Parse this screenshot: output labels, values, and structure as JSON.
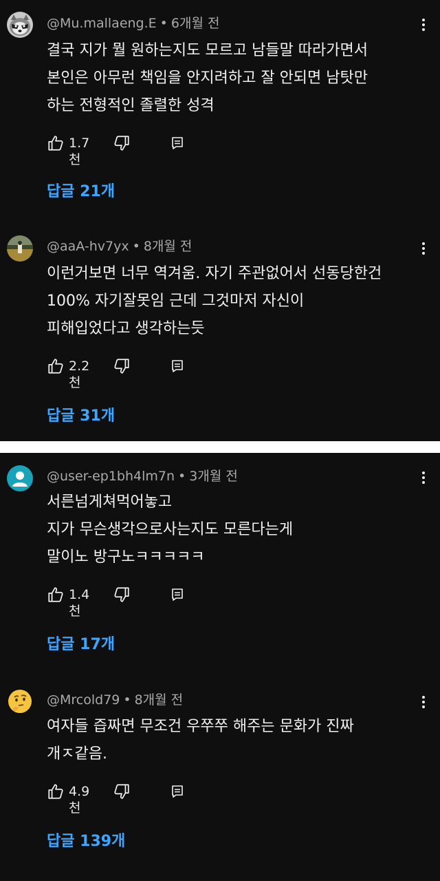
{
  "comments": [
    {
      "author": "@Mu.mallaeng.E",
      "time": "6개월 전",
      "lines": [
        "결국 지가 뭘 원하는지도 모르고 남들말 따라가면서",
        "본인은 아무런 책임을 안지려하고 잘 안되면 남탓만",
        "하는 전형적인 졸렬한 성격"
      ],
      "likes": "1.7천",
      "replies": "답글 21개",
      "avatar": "raccoon-avatar"
    },
    {
      "author": "@aaA-hv7yx",
      "time": "8개월 전",
      "lines": [
        "이런거보면 너무 역겨움. 자기 주관없어서 선동당한건",
        "100% 자기잘못임 근데 그것마저 자신이",
        "피해입었다고 생각하는듯"
      ],
      "likes": "2.2천",
      "replies": "답글 31개",
      "avatar": "field-photo-avatar"
    },
    {
      "author": "@user-ep1bh4lm7n",
      "time": "3개월 전",
      "lines": [
        "서른넘게쳐먹어놓고",
        "지가 무슨생각으로사는지도 모른다는게",
        "말이노 방구노ㅋㅋㅋㅋㅋ"
      ],
      "likes": "1.4천",
      "replies": "답글 17개",
      "avatar": "default-user-avatar"
    },
    {
      "author": "@Mrcold79",
      "time": "8개월 전",
      "lines": [
        "여자들 즙짜면 무조건 우쭈쭈 해주는 문화가 진짜",
        "개ㅈ같음."
      ],
      "likes": "4.9천",
      "replies": "답글 139개",
      "avatar": "thinking-emoji-avatar"
    }
  ],
  "separator": "•",
  "colors": {
    "background": "#0f0f0f",
    "divider": "#ffffff",
    "text": "#f1f1f1",
    "meta": "#aaaaaa",
    "link": "#3ea6ff",
    "default_avatar": "#1aa3b8"
  },
  "icons": [
    "like-icon",
    "dislike-icon",
    "reply-icon",
    "more-options-icon"
  ]
}
